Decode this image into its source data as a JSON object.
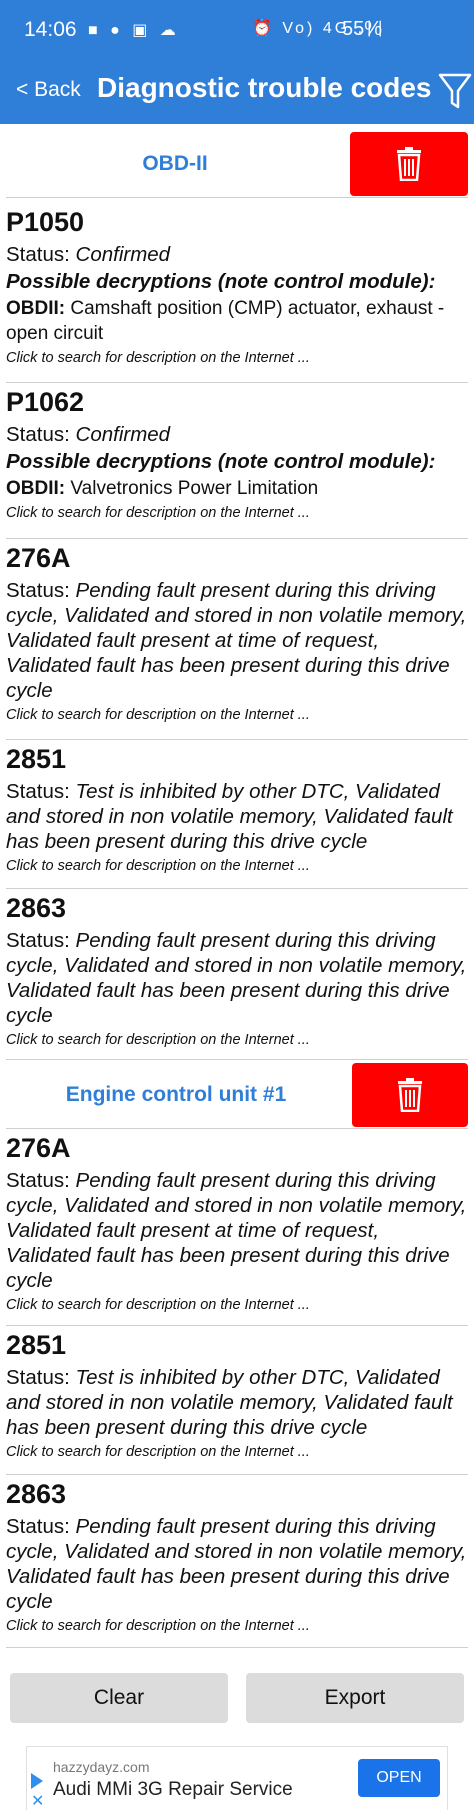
{
  "status_bar": {
    "time": "14:06",
    "left_icons": "■ ● ▣ ☁",
    "right_icons": "⏰ Vo) 4G .∣∣",
    "battery": "55%"
  },
  "app_bar": {
    "back_label": "< Back",
    "title": "Diagnostic trouble codes"
  },
  "sections": [
    {
      "title": "OBD-II",
      "codes": [
        {
          "code": "P1050",
          "status_label": "Status:",
          "status": "Confirmed",
          "possible": "Possible decryptions (note control module):",
          "obd_label": "OBDII:",
          "obd_text": "Camshaft position (CMP) actuator, exhaust - open circuit",
          "link": "Click to search for description on the Internet ..."
        },
        {
          "code": "P1062",
          "status_label": "Status:",
          "status": "Confirmed",
          "possible": "Possible decryptions (note control module):",
          "obd_label": "OBDII:",
          "obd_text": "Valvetronics Power Limitation",
          "link": "Click to search for description on the Internet ..."
        },
        {
          "code": "276A",
          "status_label": "Status:",
          "status": "Pending fault present during this driving cycle, Validated and stored in non volatile memory, Validated fault present at time of request, Validated fault has been present during this drive cycle",
          "link": "Click to search for description on the Internet ..."
        },
        {
          "code": "2851",
          "status_label": "Status:",
          "status": "Test is inhibited by other DTC, Validated and stored in non volatile memory, Validated fault has been present during this drive cycle",
          "link": "Click to search for description on the Internet ..."
        },
        {
          "code": "2863",
          "status_label": "Status:",
          "status": "Pending fault present during this driving cycle, Validated and stored in non volatile memory, Validated fault has been present during this drive cycle",
          "link": "Click to search for description on the Internet ..."
        }
      ]
    },
    {
      "title": "Engine control unit #1",
      "codes": [
        {
          "code": "276A",
          "status_label": "Status:",
          "status": "Pending fault present during this driving cycle, Validated and stored in non volatile memory, Validated fault present at time of request, Validated fault has been present during this drive cycle",
          "link": "Click to search for description on the Internet ..."
        },
        {
          "code": "2851",
          "status_label": "Status:",
          "status": "Test is inhibited by other DTC, Validated and stored in non volatile memory, Validated fault has been present during this drive cycle",
          "link": "Click to search for description on the Internet ..."
        },
        {
          "code": "2863",
          "status_label": "Status:",
          "status": "Pending fault present during this driving cycle, Validated and stored in non volatile memory, Validated fault has been present during this drive cycle",
          "link": "Click to search for description on the Internet ..."
        }
      ]
    }
  ],
  "buttons": {
    "clear": "Clear",
    "export": "Export"
  },
  "ad": {
    "domain": "hazzydayz.com",
    "title": "Audi MMi 3G Repair Service",
    "open_label": "OPEN"
  },
  "colors": {
    "app_bar": "#2f7fd8",
    "delete": "#ff0000",
    "section_title": "#2f7fd8"
  }
}
